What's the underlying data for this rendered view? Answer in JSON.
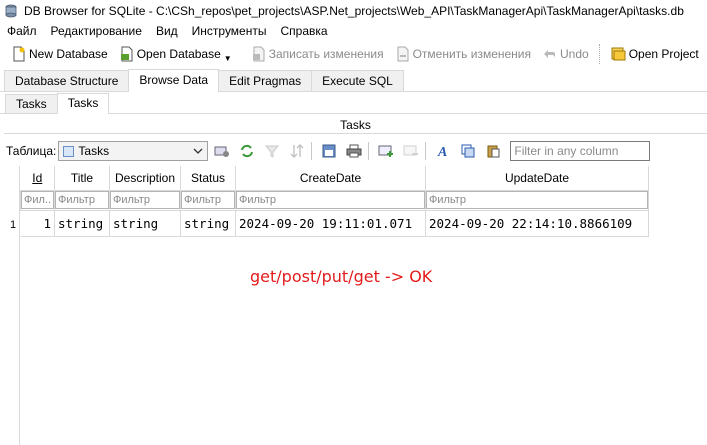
{
  "window": {
    "title": "DB Browser for SQLite - C:\\CSh_repos\\pet_projects\\ASP.Net_projects\\Web_API\\TaskManagerApi\\TaskManagerApi\\tasks.db"
  },
  "menu": [
    "Файл",
    "Редактирование",
    "Вид",
    "Инструменты",
    "Справка"
  ],
  "toolbar": {
    "new_database": "New Database",
    "open_database": "Open Database",
    "write_changes": "Записать изменения",
    "revert_changes": "Отменить изменения",
    "undo": "Undo",
    "open_project": "Open Project",
    "truncated": "S"
  },
  "main_tabs": [
    "Database Structure",
    "Browse Data",
    "Edit Pragmas",
    "Execute SQL"
  ],
  "sub_tabs": [
    "Tasks",
    "Tasks"
  ],
  "panel_title": "Tasks",
  "table_toolbar": {
    "label": "Таблица:",
    "selected_table": "Tasks",
    "filter_placeholder": "Filter in any column"
  },
  "grid": {
    "columns": [
      "Id",
      "Title",
      "Description",
      "Status",
      "CreateDate",
      "UpdateDate"
    ],
    "filter_placeholders": [
      "Фил...",
      "Фильтр",
      "Фильтр",
      "Фильтр",
      "Фильтр",
      "Фильтр"
    ],
    "rows": [
      {
        "row_number": "1",
        "cells": [
          "1",
          "string",
          "string",
          "string",
          "2024-09-20 19:11:01.071",
          "2024-09-20 22:14:10.8866109"
        ]
      }
    ]
  },
  "annotation": "get/post/put/get -> OK",
  "colors": {
    "annotation": "#e31b1b",
    "disabled_text": "#8a8a8a"
  }
}
